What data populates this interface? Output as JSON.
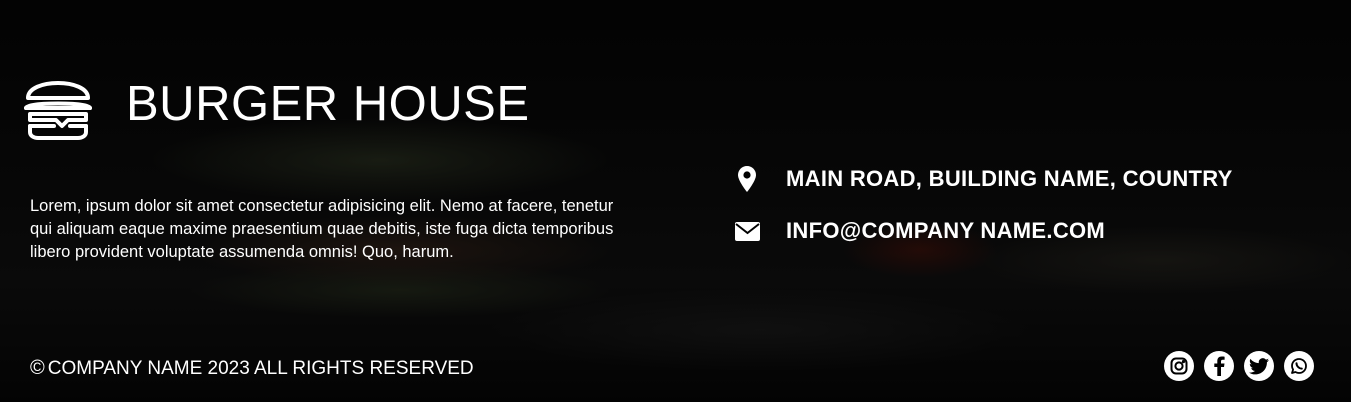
{
  "brand": {
    "icon": "burger-icon",
    "title": "BURGER HOUSE"
  },
  "about": {
    "text": "Lorem, ipsum dolor sit amet consectetur adipisicing elit. Nemo at facere, tenetur qui aliquam eaque maxime praesentium quae debitis, iste fuga dicta temporibus libero provident voluptate assumenda omnis! Quo, harum."
  },
  "contact": {
    "address": {
      "icon": "map-pin-icon",
      "text": "MAIN ROAD, BUILDING NAME, COUNTRY"
    },
    "email": {
      "icon": "envelope-icon",
      "text": "INFO@COMPANY NAME.COM"
    }
  },
  "footer": {
    "copyright_symbol": "©",
    "copyright_text": "COMPANY NAME 2023 ALL RIGHTS RESERVED"
  },
  "social": [
    {
      "icon": "instagram-icon"
    },
    {
      "icon": "facebook-icon"
    },
    {
      "icon": "twitter-icon"
    },
    {
      "icon": "whatsapp-icon"
    }
  ],
  "colors": {
    "text": "#ffffff",
    "background": "#000000",
    "social_bg": "#ffffff",
    "social_fg": "#000000"
  }
}
